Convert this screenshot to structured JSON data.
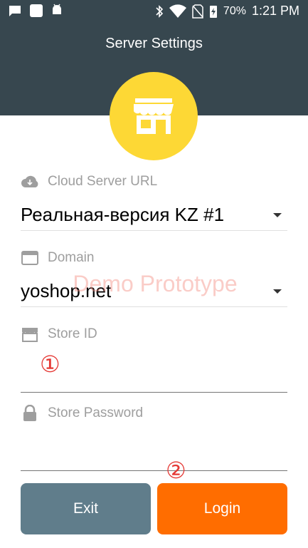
{
  "status_bar": {
    "battery": "70%",
    "time": "1:21 PM",
    "icons": [
      "chat-icon",
      "square-icon",
      "android-icon",
      "bluetooth-icon",
      "wifi-icon",
      "no-sim-icon",
      "battery-charging-icon"
    ]
  },
  "header": {
    "title": "Server Settings",
    "badge_icon": "store-icon"
  },
  "form": {
    "cloud_server": {
      "label": "Cloud Server URL",
      "value": "Реальная-версия KZ #1",
      "icon": "cloud-icon"
    },
    "domain": {
      "label": "Domain",
      "value": "yoshop.net",
      "icon": "window-icon"
    },
    "store_id": {
      "label": "Store ID",
      "value": "",
      "icon": "store-small-icon"
    },
    "store_password": {
      "label": "Store Password",
      "value": "",
      "icon": "lock-icon"
    }
  },
  "watermark": "Demo Prototype",
  "markers": {
    "one": "①",
    "two": "②"
  },
  "buttons": {
    "exit": "Exit",
    "login": "Login"
  },
  "colors": {
    "header_bg": "#37474f",
    "badge_bg": "#fdd835",
    "exit_bg": "#607d8b",
    "login_bg": "#ff6d00",
    "marker": "#e53935"
  }
}
